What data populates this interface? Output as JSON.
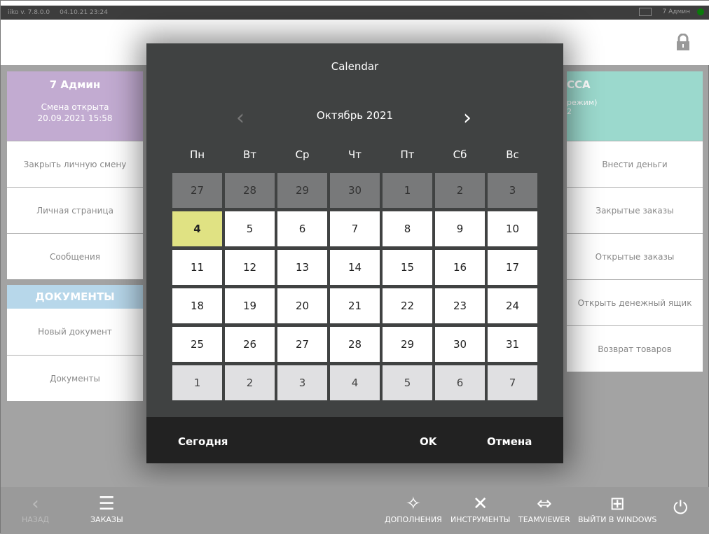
{
  "titlebar": {
    "app": "iiko  v. 7.8.0.0",
    "datetime": "04.10.21  23:24",
    "user": "7 Админ"
  },
  "left": {
    "user": "7 Админ",
    "shift_status": "Смена открыта",
    "shift_date": "20.09.2021 15:58",
    "items": [
      "Закрыть личную смену",
      "Личная страница",
      "Сообщения"
    ],
    "docs_title": "ДОКУМЕНТЫ",
    "docs_items": [
      "Новый документ",
      "Документы"
    ]
  },
  "right": {
    "title": "ССА",
    "subtitle": "режим)",
    "line": "2",
    "items": [
      "Внести деньги",
      "Закрытые заказы",
      "Открытые заказы",
      "Открыть денежный ящик",
      "Возврат товаров"
    ]
  },
  "calendar": {
    "title": "Calendar",
    "month": "Октябрь 2021",
    "days_of_week": [
      "Пн",
      "Вт",
      "Ср",
      "Чт",
      "Пт",
      "Сб",
      "Вс"
    ],
    "weeks": [
      [
        "27",
        "28",
        "29",
        "30",
        "1",
        "2",
        "3"
      ],
      [
        "4",
        "5",
        "6",
        "7",
        "8",
        "9",
        "10"
      ],
      [
        "11",
        "12",
        "13",
        "14",
        "15",
        "16",
        "17"
      ],
      [
        "18",
        "19",
        "20",
        "21",
        "22",
        "23",
        "24"
      ],
      [
        "25",
        "26",
        "27",
        "28",
        "29",
        "30",
        "31"
      ],
      [
        "1",
        "2",
        "3",
        "4",
        "5",
        "6",
        "7"
      ]
    ],
    "selected": "4",
    "today_label": "Сегодня",
    "ok_label": "OK",
    "cancel_label": "Отмена"
  },
  "toolbar": {
    "back": "НАЗАД",
    "orders": "ЗАКАЗЫ",
    "addons": "ДОПОЛНЕНИЯ",
    "tools": "ИНСТРУМЕНТЫ",
    "teamviewer": "TEAMVIEWER",
    "exit": "ВЫЙТИ В WINDOWS"
  }
}
